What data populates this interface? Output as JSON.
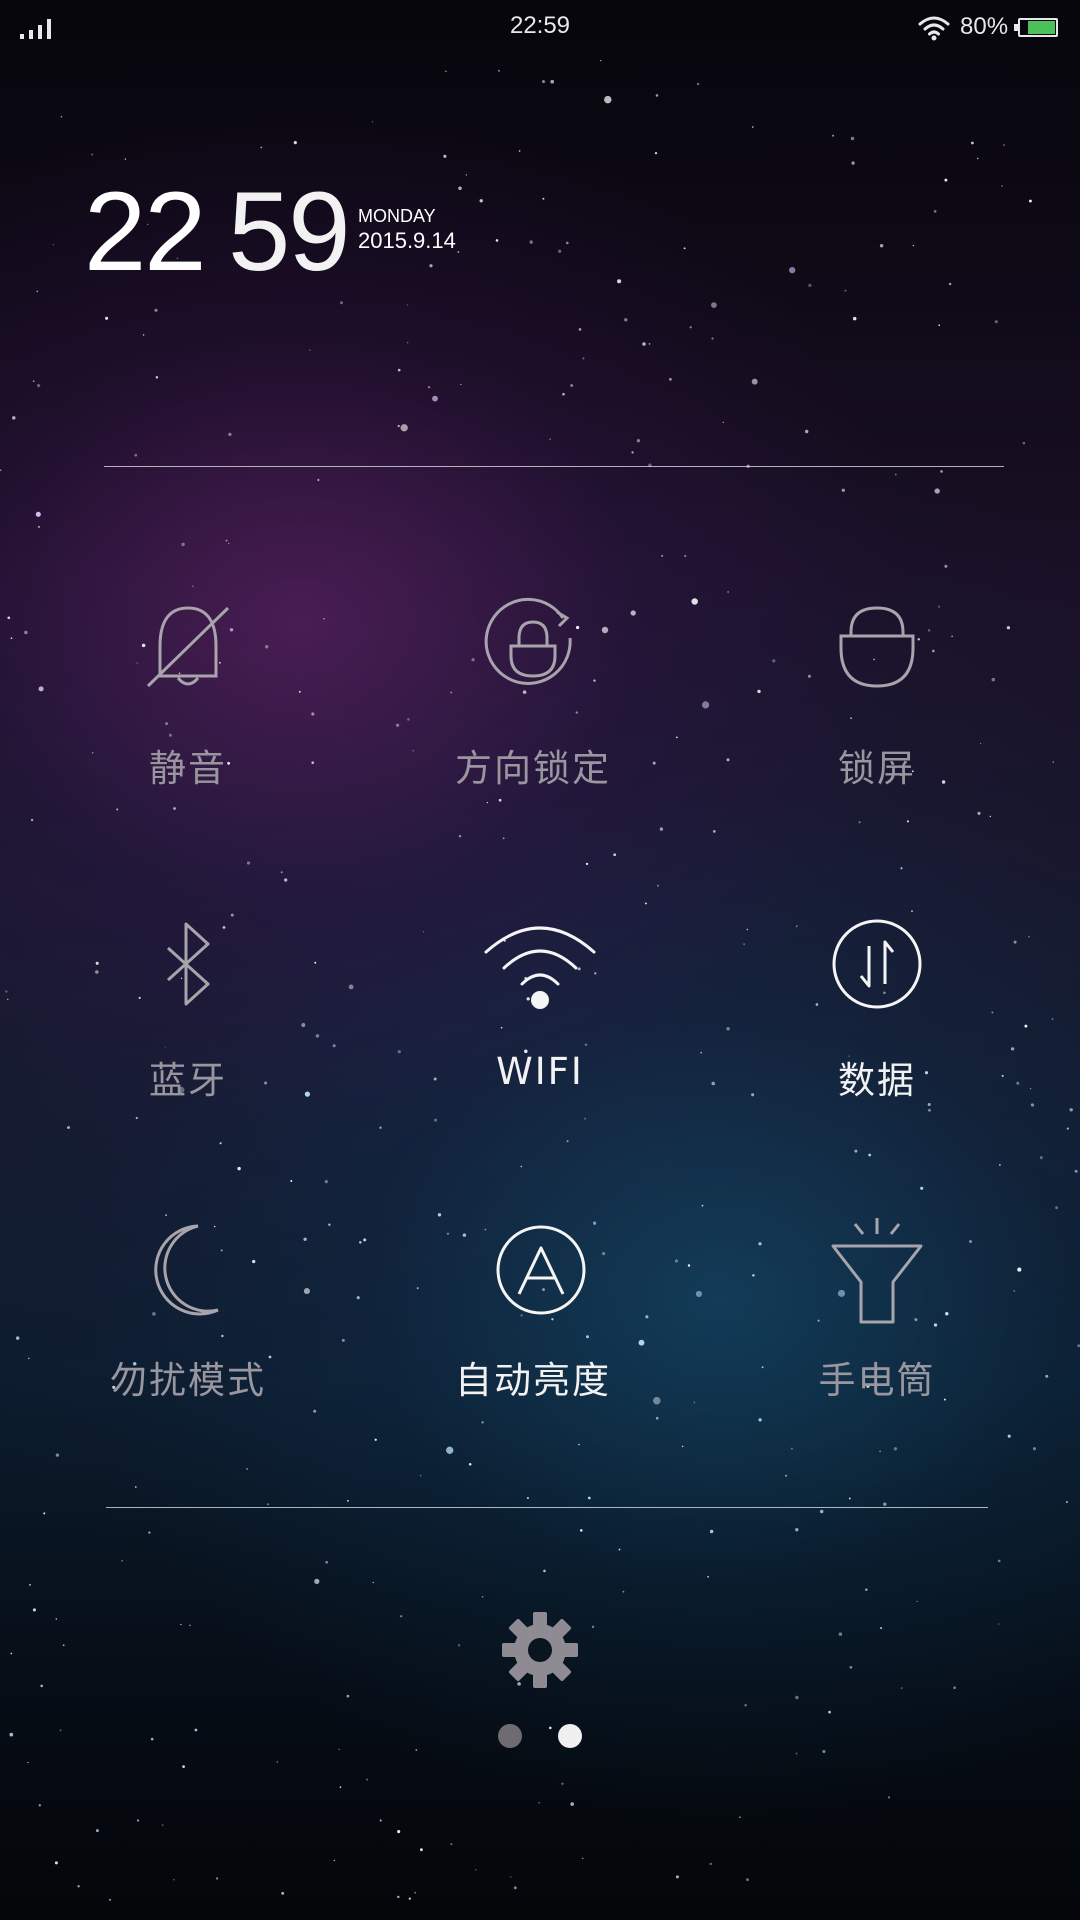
{
  "status_bar": {
    "time": "22:59",
    "battery_percent": "80%",
    "battery_level": 0.8,
    "battery_color": "#4cc15b"
  },
  "clock": {
    "hours": "22",
    "minutes": "59",
    "day": "MONDAY",
    "date": "2015.9.14"
  },
  "toggles": [
    {
      "label": "静音",
      "icon": "bell-muted-icon",
      "active": false
    },
    {
      "label": "方向锁定",
      "icon": "rotation-lock-icon",
      "active": false
    },
    {
      "label": "锁屏",
      "icon": "lock-screen-icon",
      "active": false
    },
    {
      "label": "蓝牙",
      "icon": "bluetooth-icon",
      "active": false
    },
    {
      "label": "WIFI",
      "icon": "wifi-icon",
      "active": true
    },
    {
      "label": "数据",
      "icon": "mobile-data-icon",
      "active": true
    },
    {
      "label": "勿扰模式",
      "icon": "moon-icon",
      "active": false
    },
    {
      "label": "自动亮度",
      "icon": "auto-brightness-icon",
      "active": true
    },
    {
      "label": "手电筒",
      "icon": "flashlight-icon",
      "active": false
    }
  ],
  "settings": {
    "icon": "gear-icon"
  },
  "pager": {
    "count": 2,
    "current": 2
  },
  "colors": {
    "active_text": "#f2f2f2",
    "inactive_text": "#9a96a0",
    "inactive_icon": "#a8a4ac",
    "active_icon": "#f5f5f5"
  }
}
